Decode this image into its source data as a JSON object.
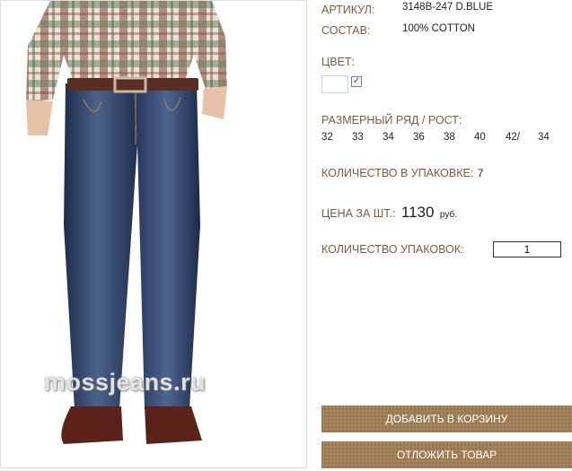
{
  "product": {
    "sku_label": "АРТИКУЛ:",
    "sku_value": "3148B-247 D.BLUE",
    "composition_label": "СОСТАВ:",
    "composition_value": "100% COTTON",
    "color_label": "ЦВЕТ:",
    "color_checked": true,
    "size_label": "РАЗМЕРНЫЙ РЯД / РОСТ:",
    "sizes": [
      "32",
      "33",
      "34",
      "36",
      "38",
      "40",
      "42/",
      "34"
    ],
    "pack_qty_label": "КОЛИЧЕСТВО В УПАКОВКЕ:",
    "pack_qty_value": "7",
    "price_label": "ЦЕНА ЗА ШТ.:",
    "price_value": "1130",
    "price_unit": "руб.",
    "packs_label": "КОЛИЧЕСТВО УПАКОВОК:",
    "packs_value": "1"
  },
  "photo": {
    "watermark": "mossjeans.ru"
  },
  "buttons": {
    "add_to_cart": "ДОБАВИТЬ В КОРЗИНУ",
    "defer": "ОТЛОЖИТЬ ТОВАР"
  },
  "colors": {
    "label_brown": "#7a5c3c",
    "button_brown": "#9b7a52",
    "denim": "#2c3e62"
  }
}
